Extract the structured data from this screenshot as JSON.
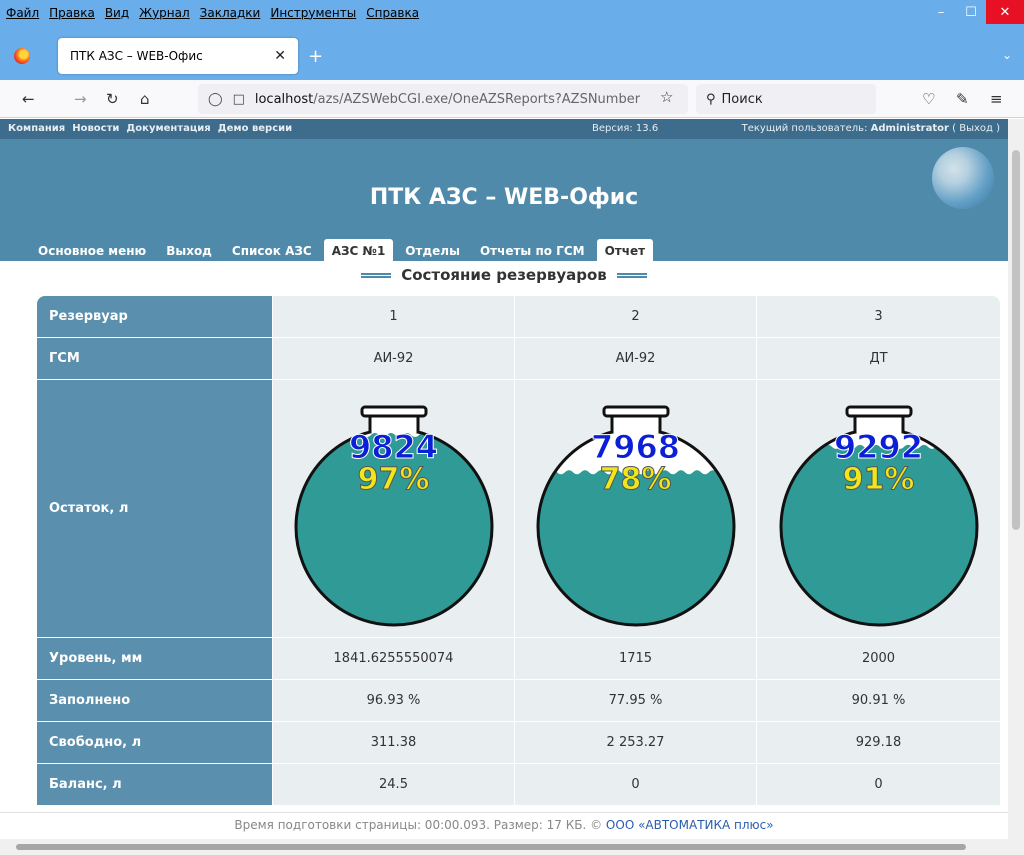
{
  "browser": {
    "menu": [
      "Файл",
      "Правка",
      "Вид",
      "Журнал",
      "Закладки",
      "Инструменты",
      "Справка"
    ],
    "tab_title": "ПТК АЗС – WEB-Офис",
    "url_host": "localhost",
    "url_path": "/azs/AZSWebCGI.exe/OneAZSReports?AZSNumber",
    "search_placeholder": "Поиск"
  },
  "topline": {
    "links": [
      "Компания",
      "Новости",
      "Документация",
      "Демо версии"
    ],
    "version": "Версия: 13.6",
    "user_prefix": "Текущий пользователь:",
    "user_name": "Administrator",
    "logout": "( Выход )"
  },
  "header": {
    "title": "ПТК АЗС – WEB-Офис",
    "tabs": [
      "Основное меню",
      "Выход",
      "Список АЗС",
      "АЗС №1",
      "Отделы",
      "Отчеты по ГСМ",
      "Отчет"
    ],
    "active_tabs": [
      "АЗС №1",
      "Отчет"
    ]
  },
  "section_title": "Состояние резервуаров",
  "table": {
    "labels": {
      "tank": "Резервуар",
      "fuel": "ГСМ",
      "remaining": "Остаток, л",
      "level": "Уровень, мм",
      "filled": "Заполнено",
      "free": "Свободно, л",
      "balance": "Баланс, л"
    },
    "tanks": [
      {
        "number": "1",
        "fuel": "АИ-92",
        "volume_text": "9824",
        "percent_text": "97%",
        "fill_fraction": 0.9693,
        "level": "1841.6255550074",
        "filled": "96.93 %",
        "free": "311.38",
        "balance": "24.5"
      },
      {
        "number": "2",
        "fuel": "АИ-92",
        "volume_text": "7968",
        "percent_text": "78%",
        "fill_fraction": 0.7795,
        "level": "1715",
        "filled": "77.95 %",
        "free": "2 253.27",
        "balance": "0"
      },
      {
        "number": "3",
        "fuel": "ДТ",
        "volume_text": "9292",
        "percent_text": "91%",
        "fill_fraction": 0.9091,
        "level": "2000",
        "filled": "90.91 %",
        "free": "929.18",
        "balance": "0"
      }
    ]
  },
  "footer": {
    "text": "Время подготовки страницы: 00:00.093. Размер: 17 КБ. ©",
    "company": "ООО «АВТОМАТИКА плюс»"
  },
  "colors": {
    "header_bg": "#4f8aaa",
    "label_bg": "#5b8fae",
    "liquid": "#2f9a96"
  }
}
